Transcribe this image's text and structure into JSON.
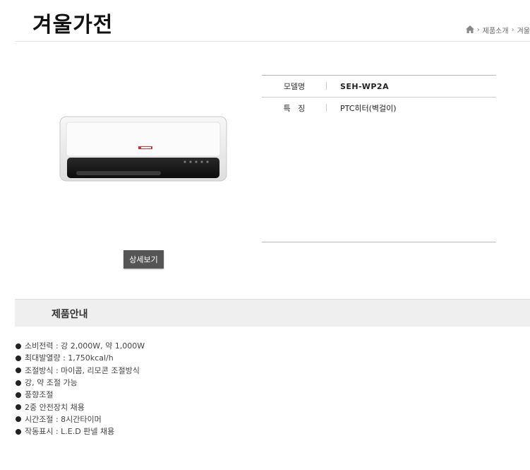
{
  "header": {
    "title": "겨울가전",
    "breadcrumb": [
      "제품소개",
      "겨울"
    ]
  },
  "product": {
    "detail_button": "상세보기",
    "specs": [
      {
        "label": "모델명",
        "value": "SEH-WP2A"
      },
      {
        "label": "특   징",
        "value": "PTC히터(벽걸이)"
      }
    ]
  },
  "section": {
    "title": "제품안내"
  },
  "features": [
    "소비전력 : 강 2,000W, 약 1,000W",
    "최대발열량 : 1,750kcal/h",
    "조절방식 : 마이콤, 리모콘 조절방식",
    "강, 약 조절 가능",
    "풍향조절",
    "2중 안전장치 채용",
    "시간조절 : 8시간타이머",
    "작동표시 : L.E.D 판넬 채용"
  ]
}
